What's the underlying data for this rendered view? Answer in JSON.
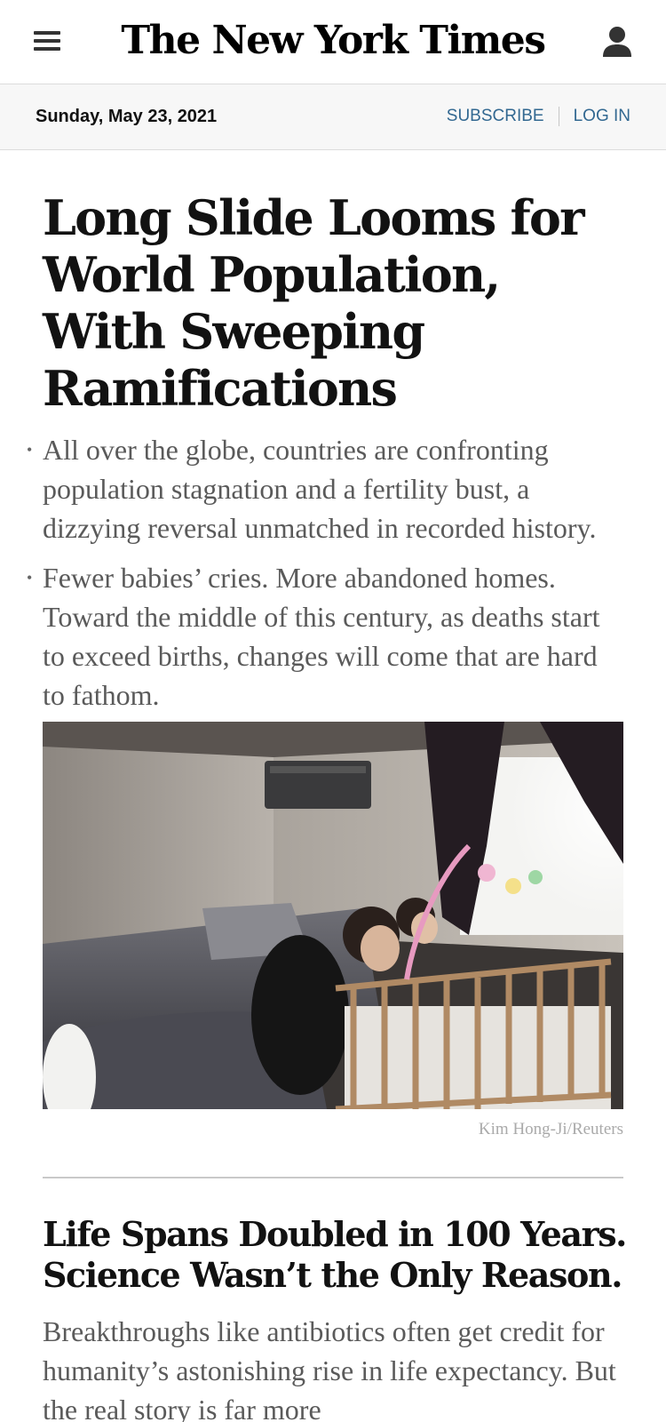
{
  "header": {
    "logo": "The New York Times",
    "menu_icon": "hamburger-menu-icon",
    "account_icon": "user-account-icon"
  },
  "datebar": {
    "date": "Sunday, May 23, 2021",
    "subscribe": "SUBSCRIBE",
    "login": "LOG IN"
  },
  "lead_story": {
    "headline": "Long Slide Looms for World Population, With Sweeping Ramifications",
    "summary": [
      "All over the globe, countries are confronting population stagnation and a fertility bust, a dizzying reversal unmatched in recorded history.",
      "Fewer babies’ cries. More abandoned homes. Toward the middle of this century, as deaths start to exceed births, changes will come that are hard to fathom."
    ],
    "photo_credit": "Kim Hong-Ji/Reuters"
  },
  "second_story": {
    "headline": "Life Spans Doubled in 100 Years. Science Wasn’t the Only Reason.",
    "summary": "Breakthroughs like antibiotics often get credit for humanity’s astonishing rise in life expectancy. But the real story is far more"
  },
  "colors": {
    "link": "#326891",
    "summary_text": "#5a5a5a",
    "datebar_bg": "#f7f7f7"
  }
}
